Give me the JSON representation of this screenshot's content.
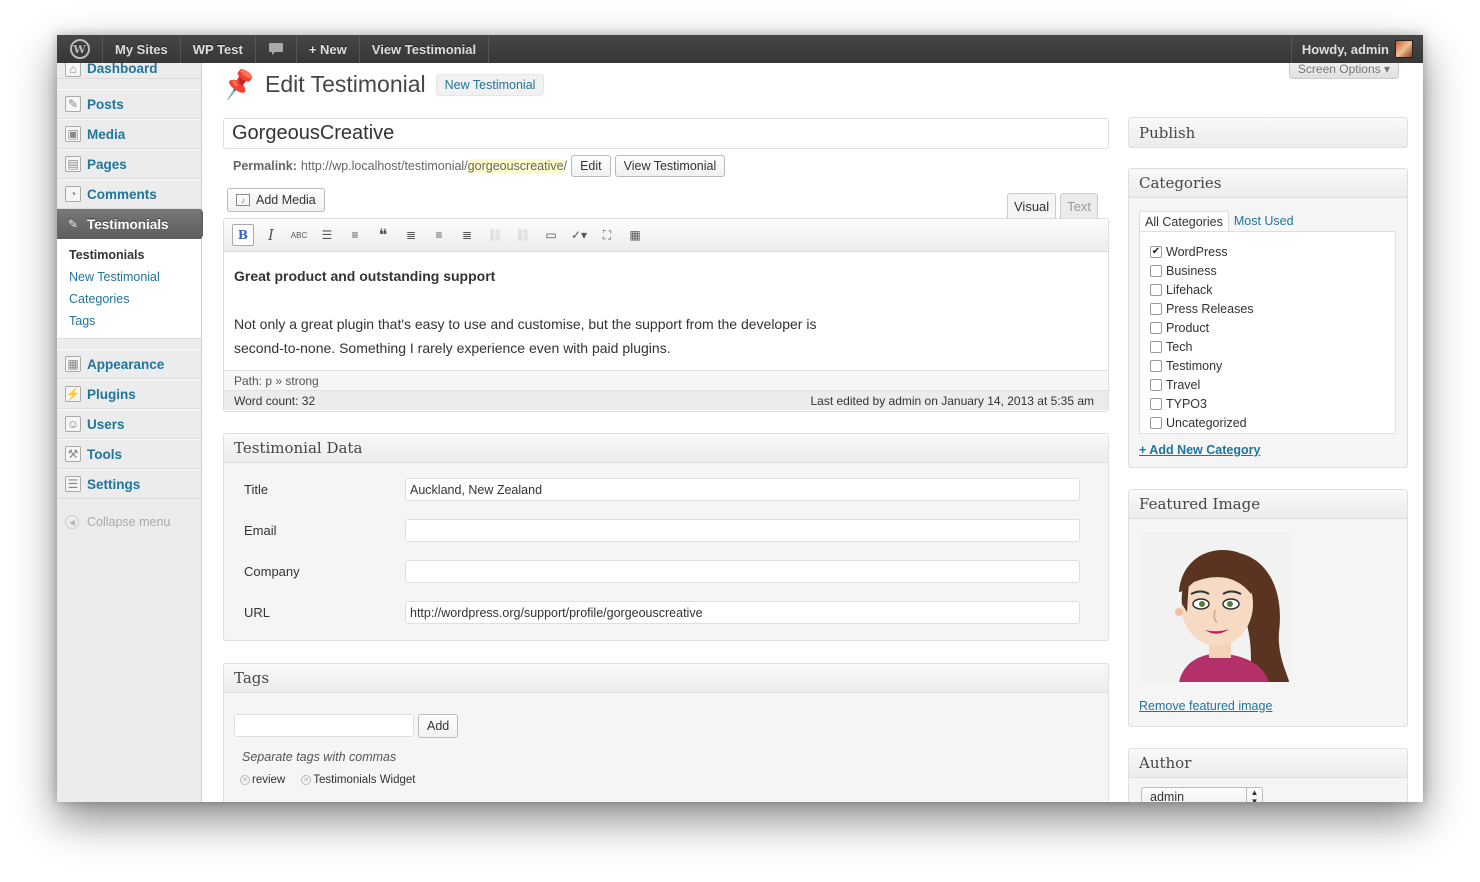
{
  "adminbar": {
    "logo": "W",
    "items": [
      "My Sites",
      "WP Test",
      "+ New",
      "View Testimonial"
    ],
    "comments_icon": "speech-bubble-icon",
    "howdy": "Howdy, admin"
  },
  "sidebar": {
    "items": [
      {
        "label": "Dashboard",
        "icon": "home-icon"
      },
      {
        "label": "Posts",
        "icon": "pin-icon"
      },
      {
        "label": "Media",
        "icon": "media-icon"
      },
      {
        "label": "Pages",
        "icon": "pages-icon"
      },
      {
        "label": "Comments",
        "icon": "comments-icon"
      },
      {
        "label": "Testimonials",
        "icon": "pin-icon"
      },
      {
        "label": "Appearance",
        "icon": "appearance-icon"
      },
      {
        "label": "Plugins",
        "icon": "plugins-icon"
      },
      {
        "label": "Users",
        "icon": "users-icon"
      },
      {
        "label": "Tools",
        "icon": "tools-icon"
      },
      {
        "label": "Settings",
        "icon": "settings-icon"
      }
    ],
    "submenu": [
      "Testimonials",
      "New Testimonial",
      "Categories",
      "Tags"
    ],
    "collapse": "Collapse menu"
  },
  "header": {
    "screen_options": "Screen Options ▾",
    "title": "Edit Testimonial",
    "add_new": "New Testimonial"
  },
  "post": {
    "title": "GorgeousCreative",
    "permalink_label": "Permalink:",
    "permalink_base": "http://wp.localhost/testimonial/",
    "permalink_slug": "gorgeouscreative",
    "permalink_end": "/",
    "edit_btn": "Edit",
    "view_btn": "View Testimonial"
  },
  "editor": {
    "add_media": "Add Media",
    "tab_visual": "Visual",
    "tab_text": "Text",
    "bold": "B",
    "italic": "I",
    "strike": "ABC",
    "content_strong": "Great product and outstanding support",
    "content_line1": "Not only a great plugin that's easy to use and customise, but the support from the developer is",
    "content_line2": "second-to-none. Something I rarely experience even with paid plugins.",
    "path": "Path: p » strong",
    "word_count": "Word count: 32",
    "last_edited": "Last edited by admin on January 14, 2013 at 5:35 am"
  },
  "testimonial_data": {
    "heading": "Testimonial Data",
    "fields": [
      {
        "label": "Title",
        "value": "Auckland, New Zealand"
      },
      {
        "label": "Email",
        "value": ""
      },
      {
        "label": "Company",
        "value": ""
      },
      {
        "label": "URL",
        "value": "http://wordpress.org/support/profile/gorgeouscreative"
      }
    ]
  },
  "tags": {
    "heading": "Tags",
    "add_btn": "Add",
    "hint": "Separate tags with commas",
    "items": [
      "review",
      "Testimonials Widget"
    ]
  },
  "publish": {
    "heading": "Publish"
  },
  "categories": {
    "heading": "Categories",
    "tab_all": "All Categories",
    "tab_most": "Most Used",
    "items": [
      {
        "label": "WordPress",
        "checked": true
      },
      {
        "label": "Business",
        "checked": false
      },
      {
        "label": "Lifehack",
        "checked": false
      },
      {
        "label": "Press Releases",
        "checked": false
      },
      {
        "label": "Product",
        "checked": false
      },
      {
        "label": "Tech",
        "checked": false
      },
      {
        "label": "Testimony",
        "checked": false
      },
      {
        "label": "Travel",
        "checked": false
      },
      {
        "label": "TYPO3",
        "checked": false
      },
      {
        "label": "Uncategorized",
        "checked": false
      }
    ],
    "add_new": "+ Add New Category"
  },
  "featured": {
    "heading": "Featured Image",
    "remove": "Remove featured image"
  },
  "author": {
    "heading": "Author",
    "selected": "admin"
  },
  "colors": {
    "link": "#21759b",
    "adminbar": "#464646"
  }
}
